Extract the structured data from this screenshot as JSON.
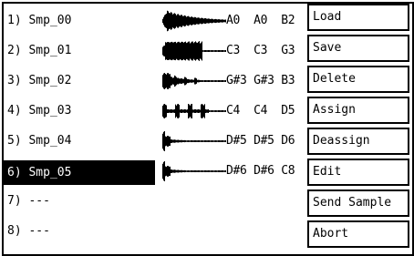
{
  "samples": [
    {
      "label": "1) Smp_00",
      "notes": "A0  A0  B2",
      "waveform": "wave-large-tapered"
    },
    {
      "label": "2) Smp_01",
      "notes": "C3  C3  G3",
      "waveform": "wave-dense-block"
    },
    {
      "label": "3) Smp_02",
      "notes": "G#3 G#3 B3",
      "waveform": "wave-decaying-bursts"
    },
    {
      "label": "4) Smp_03",
      "notes": "C4  C4  D5",
      "waveform": "wave-periodic-bursts"
    },
    {
      "label": "5) Smp_04",
      "notes": "D#5 D#5 D6",
      "waveform": "wave-attack-decay"
    },
    {
      "label": "6) Smp_05",
      "notes": "D#6 D#6 C8",
      "waveform": "wave-attack-decay"
    },
    {
      "label": "7) ---",
      "notes": "",
      "waveform": ""
    },
    {
      "label": "8) ---",
      "notes": "",
      "waveform": ""
    }
  ],
  "selected_index": 5,
  "menu": {
    "load": "Load",
    "save": "Save",
    "delete": "Delete",
    "assign": "Assign",
    "deassign": "Deassign",
    "edit": "Edit",
    "send_sample": "Send Sample",
    "abort": "Abort"
  },
  "colors": {
    "foreground": "#000000",
    "background": "#ffffff",
    "selection": "#000000"
  }
}
